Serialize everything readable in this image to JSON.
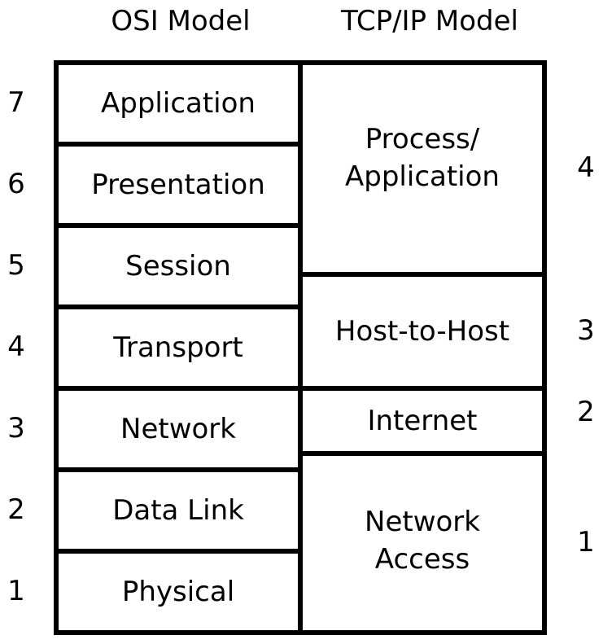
{
  "headers": {
    "osi": "OSI Model",
    "tcpip": "TCP/IP Model"
  },
  "osi_layers": [
    {
      "number": "7",
      "name": "Application"
    },
    {
      "number": "6",
      "name": "Presentation"
    },
    {
      "number": "5",
      "name": "Session"
    },
    {
      "number": "4",
      "name": "Transport"
    },
    {
      "number": "3",
      "name": "Network"
    },
    {
      "number": "2",
      "name": "Data Link"
    },
    {
      "number": "1",
      "name": "Physical"
    }
  ],
  "tcpip_layers": [
    {
      "number": "4",
      "name": "Process/\nApplication",
      "spans_osi": [
        7,
        6,
        5
      ]
    },
    {
      "number": "3",
      "name": "Host-to-Host",
      "spans_osi": [
        4
      ]
    },
    {
      "number": "2",
      "name": "Internet",
      "spans_osi": [
        3
      ]
    },
    {
      "number": "1",
      "name": "Network\nAccess",
      "spans_osi": [
        2,
        1
      ]
    }
  ],
  "colors": {
    "line": "#000000",
    "background": "#ffffff",
    "text": "#000000"
  }
}
